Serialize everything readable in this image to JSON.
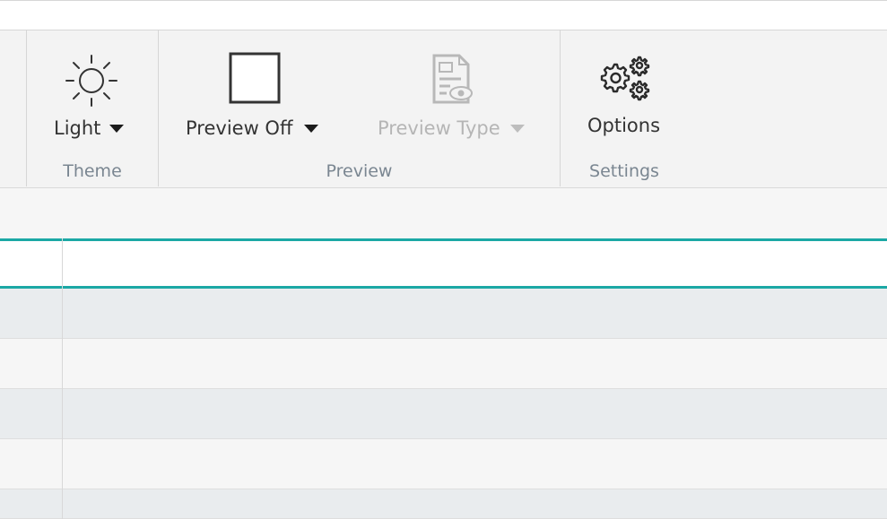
{
  "ribbon": {
    "theme_group": {
      "label": "Theme",
      "button": {
        "label": "Light",
        "icon": "sun-icon"
      }
    },
    "preview_group": {
      "label": "Preview",
      "preview_button": {
        "label": "Preview Off",
        "icon": "checkbox-empty-icon"
      },
      "preview_type_button": {
        "label": "Preview Type",
        "icon": "document-eye-icon",
        "disabled": true
      }
    },
    "settings_group": {
      "label": "Settings",
      "options_button": {
        "label": "Options",
        "icon": "gears-icon"
      }
    }
  },
  "colors": {
    "accent": "#1ba8a5",
    "group_label": "#7a8691",
    "disabled": "#b5b5b5"
  },
  "grid": {
    "header": [
      "",
      ""
    ],
    "rows": [
      [
        "",
        ""
      ],
      [
        "",
        ""
      ],
      [
        "",
        ""
      ],
      [
        "",
        ""
      ],
      [
        "",
        ""
      ]
    ]
  }
}
